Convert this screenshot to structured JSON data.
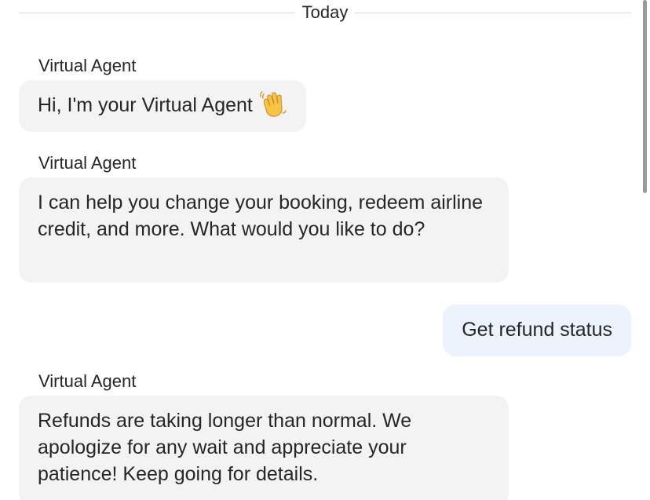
{
  "divider": {
    "label": "Today"
  },
  "messages": [
    {
      "sender": "Virtual Agent",
      "text": "Hi, I'm your Virtual Agent",
      "emoji": "waving-hand-icon"
    },
    {
      "sender": "Virtual Agent",
      "text": "I can help you change your booking, redeem airline credit, and more. What would you like to do?"
    },
    {
      "sender": "user",
      "text": "Get refund status"
    },
    {
      "sender": "Virtual Agent",
      "text": "Refunds are taking longer than normal. We apologize for any wait and appreciate your patience! Keep going for details."
    }
  ],
  "colors": {
    "agent_bubble": "#f3f3f3",
    "user_bubble": "#ecf3fd",
    "divider_line": "#d9d9d9",
    "text": "#262626"
  }
}
